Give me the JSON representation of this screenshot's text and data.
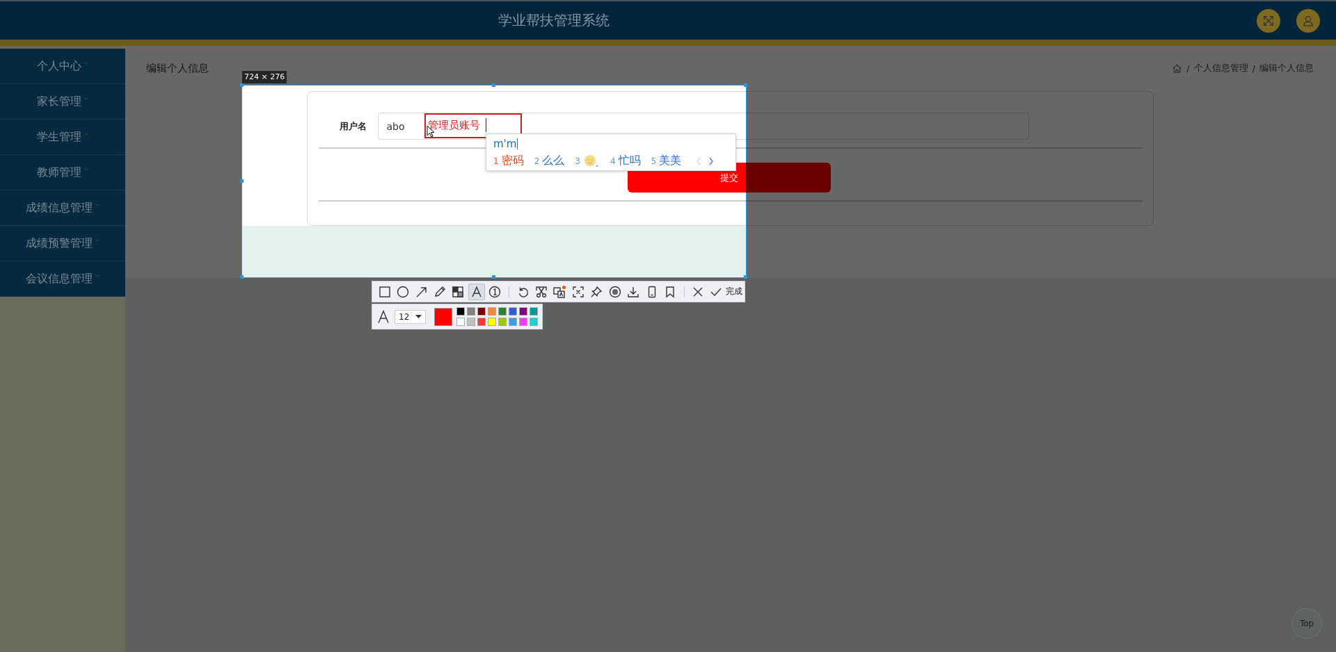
{
  "header": {
    "title": "学业帮扶管理系统"
  },
  "sidebar": {
    "items": [
      {
        "label": "个人中心"
      },
      {
        "label": "家长管理"
      },
      {
        "label": "学生管理"
      },
      {
        "label": "教师管理"
      },
      {
        "label": "成绩信息管理"
      },
      {
        "label": "成绩预警管理"
      },
      {
        "label": "会议信息管理"
      }
    ]
  },
  "page": {
    "title": "编辑个人信息",
    "breadcrumb_separator": "/",
    "breadcrumb": [
      "个人信息管理",
      "编辑个人信息"
    ]
  },
  "form": {
    "fields": [
      {
        "label": "用户名",
        "value": "abo"
      }
    ],
    "submit": "提交"
  },
  "capture": {
    "size_label": "724 × 276",
    "annotation": "管理员账号",
    "ime": {
      "composition": "m'm",
      "candidates": [
        {
          "kind": "word",
          "number": "1",
          "text": "密码",
          "selected": true
        },
        {
          "kind": "word",
          "number": "2",
          "text": "么么",
          "selected": false
        },
        {
          "kind": "emoji",
          "number": "3",
          "selected": false
        },
        {
          "kind": "word",
          "number": "4",
          "text": "忙吗",
          "selected": false
        },
        {
          "kind": "word",
          "number": "5",
          "text": "美美",
          "selected": false
        }
      ],
      "pager": [
        {
          "kind": "prev",
          "disabled": true
        },
        {
          "kind": "next",
          "disabled": false
        }
      ]
    },
    "toolbar": {
      "groups": [
        [
          {
            "kind": "rectangle",
            "selected": false
          },
          {
            "kind": "ellipse",
            "selected": false
          },
          {
            "kind": "arrow",
            "selected": false
          },
          {
            "kind": "pencil",
            "selected": false
          },
          {
            "kind": "mosaic",
            "selected": false
          },
          {
            "kind": "text",
            "selected": true
          },
          {
            "kind": "number",
            "selected": false
          }
        ],
        [
          {
            "kind": "undo"
          },
          {
            "kind": "scissors"
          },
          {
            "kind": "translate"
          },
          {
            "kind": "ocr"
          },
          {
            "kind": "pin"
          },
          {
            "kind": "record"
          },
          {
            "kind": "download"
          },
          {
            "kind": "phone"
          },
          {
            "kind": "bookmark"
          }
        ],
        [
          {
            "kind": "close"
          },
          {
            "kind": "done",
            "label": "完成"
          }
        ]
      ]
    },
    "text_options": {
      "font_size": "12",
      "current_swatch": {
        "color": "#ff0000"
      },
      "palette": [
        {
          "color": "#000000"
        },
        {
          "color": "#808080"
        },
        {
          "color": "#800000"
        },
        {
          "color": "#f7883a"
        },
        {
          "color": "#308430"
        },
        {
          "color": "#385ad3"
        },
        {
          "color": "#800080"
        },
        {
          "color": "#009999"
        },
        {
          "color": "#ffffff"
        },
        {
          "color": "#c0c0c0"
        },
        {
          "color": "#fb3838"
        },
        {
          "color": "#ffff00"
        },
        {
          "color": "#99cc00"
        },
        {
          "color": "#3d9ee8"
        },
        {
          "color": "#fb3afb"
        },
        {
          "color": "#22ccd8"
        }
      ]
    }
  },
  "top_button": "Top"
}
